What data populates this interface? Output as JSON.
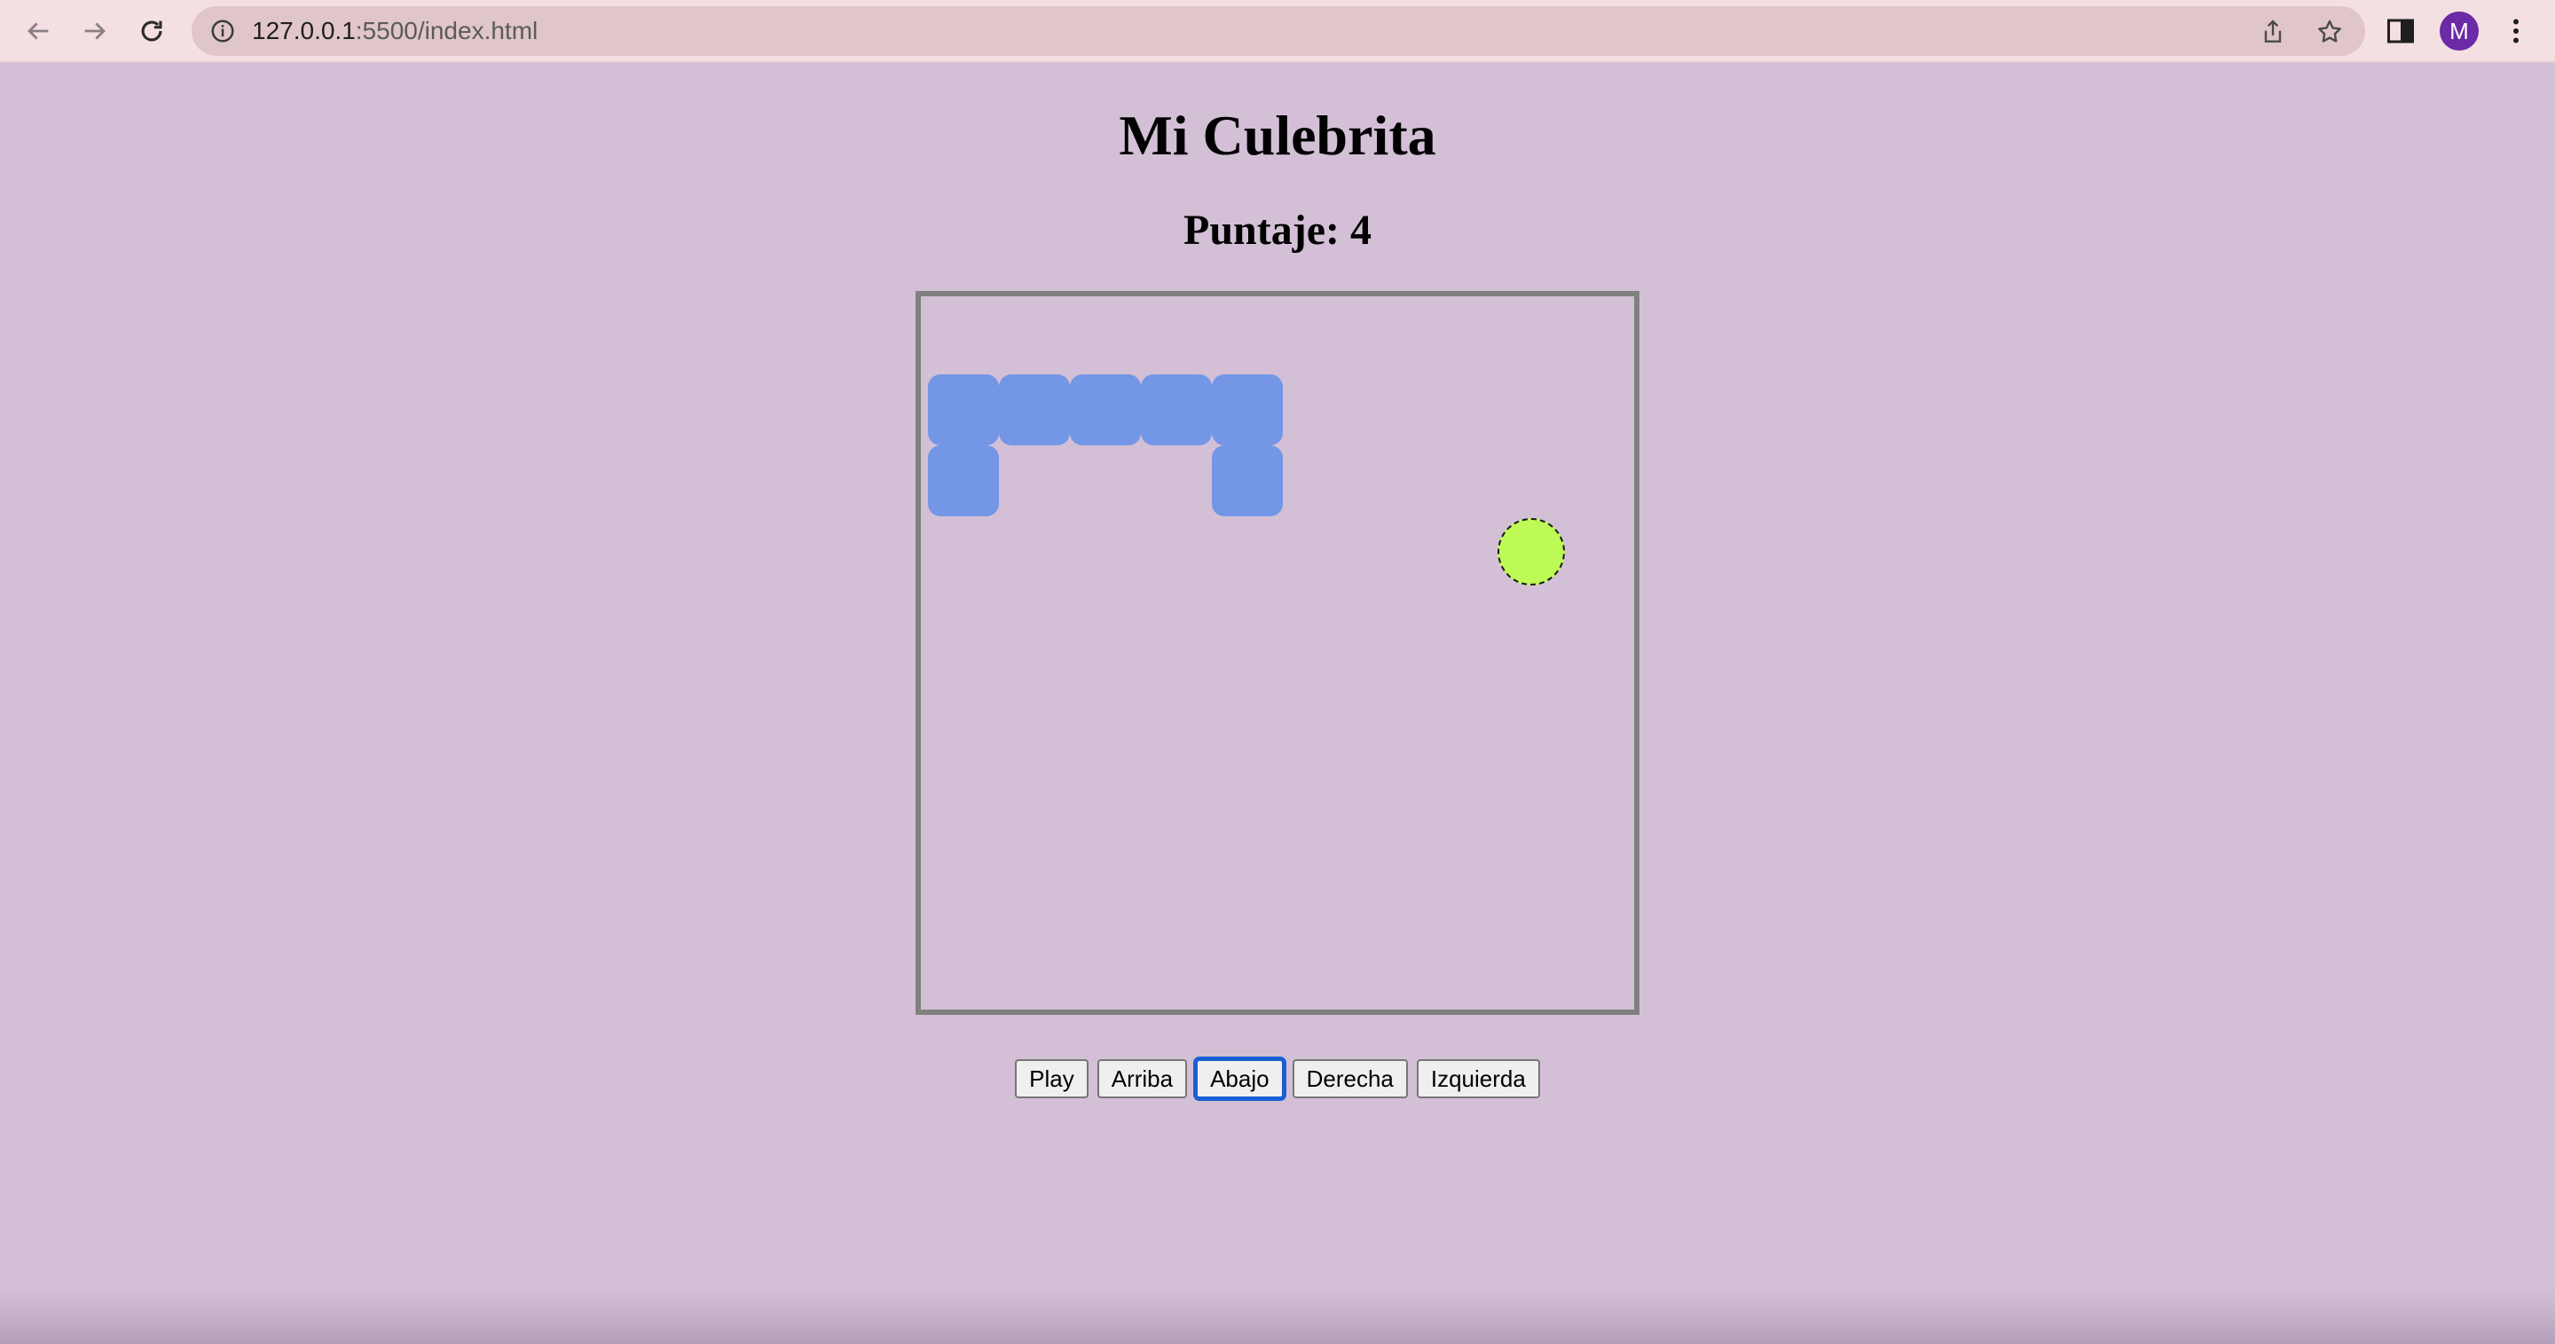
{
  "browser": {
    "url_host": "127.0.0.1",
    "url_path": ":5500/index.html",
    "profile_initial": "M"
  },
  "game": {
    "title": "Mi Culebrita",
    "score_label": "Puntaje: 4",
    "snake_color": "#7396e6",
    "food_color": "#bdfa56",
    "board_border_color": "#808080",
    "background_color": "#d3c0d6",
    "grid_size": 10,
    "snake_cells": [
      {
        "col": 0,
        "row": 1
      },
      {
        "col": 1,
        "row": 1
      },
      {
        "col": 2,
        "row": 1
      },
      {
        "col": 3,
        "row": 1
      },
      {
        "col": 4,
        "row": 1
      },
      {
        "col": 0,
        "row": 2
      },
      {
        "col": 4,
        "row": 2
      }
    ],
    "food_cell": {
      "col": 8,
      "row": 3
    }
  },
  "controls": {
    "play": "Play",
    "up": "Arriba",
    "down": "Abajo",
    "right": "Derecha",
    "left": "Izquierda",
    "focused": "down"
  }
}
